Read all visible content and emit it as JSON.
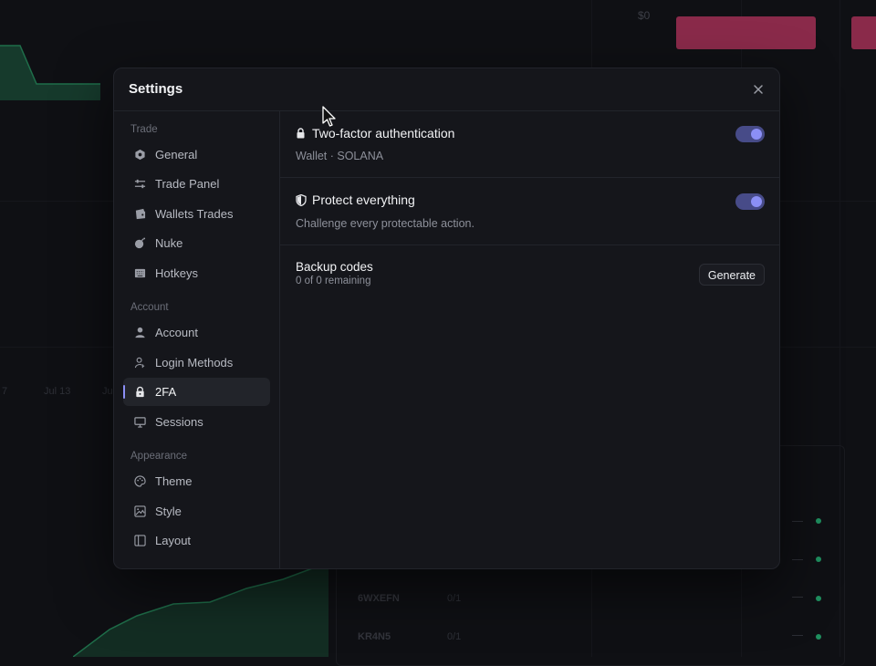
{
  "background": {
    "price_label": "$0",
    "dates": [
      "7",
      "Jul 13",
      "Ju"
    ],
    "rows": [
      {
        "id": "6WXEFN",
        "ratio": "0/1"
      },
      {
        "id": "KR4N5",
        "ratio": "0/1"
      }
    ]
  },
  "modal": {
    "title": "Settings",
    "sidebar": {
      "sections": [
        {
          "label": "Trade",
          "items": [
            {
              "label": "General",
              "icon": "hexagon-icon"
            },
            {
              "label": "Trade Panel",
              "icon": "sliders-icon"
            },
            {
              "label": "Wallets Trades",
              "icon": "wallet-icon"
            },
            {
              "label": "Nuke",
              "icon": "bomb-icon"
            },
            {
              "label": "Hotkeys",
              "icon": "keyboard-icon"
            }
          ]
        },
        {
          "label": "Account",
          "items": [
            {
              "label": "Account",
              "icon": "user-icon"
            },
            {
              "label": "Login Methods",
              "icon": "user-key-icon"
            },
            {
              "label": "2FA",
              "icon": "lock-icon",
              "active": true
            },
            {
              "label": "Sessions",
              "icon": "monitor-icon"
            }
          ]
        },
        {
          "label": "Appearance",
          "items": [
            {
              "label": "Theme",
              "icon": "palette-icon"
            },
            {
              "label": "Style",
              "icon": "image-icon"
            },
            {
              "label": "Layout",
              "icon": "layout-icon"
            }
          ]
        }
      ]
    },
    "settings": {
      "two_factor": {
        "title": "Two-factor authentication",
        "description": "Wallet · SOLANA",
        "enabled": true
      },
      "protect_everything": {
        "title": "Protect everything",
        "description": "Challenge every protectable action.",
        "enabled": true
      },
      "backup_codes": {
        "title": "Backup codes",
        "description": "0 of 0 remaining",
        "button_label": "Generate"
      }
    }
  },
  "colors": {
    "accent": "#8b8ff5",
    "toggle_track": "#474b88",
    "modal_bg": "#15161b",
    "page_bg": "#0f1014"
  }
}
